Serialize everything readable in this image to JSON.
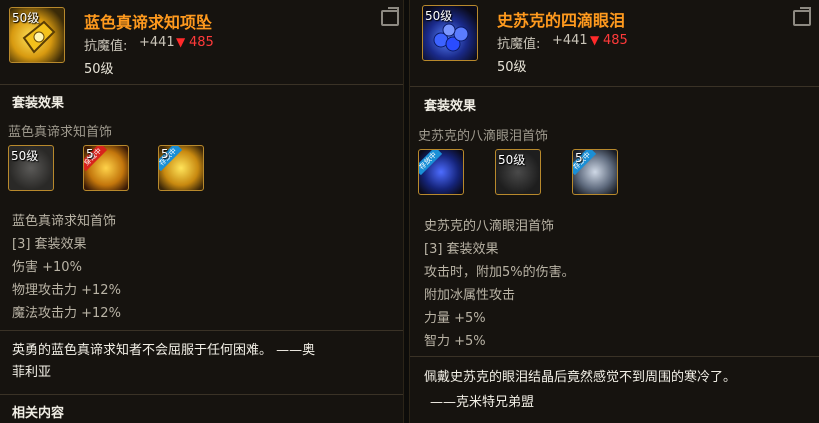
{
  "left": {
    "item_level_tag": "50级",
    "item_name": "蓝色真谛求知项坠",
    "stat_label": "抗魔值:",
    "stat_base": "+441",
    "stat_upgrade": "485",
    "level": "50级",
    "set_header": "套装效果",
    "set_name": "蓝色真谛求知首饰",
    "slots": [
      {
        "tag": "50级",
        "owned": false
      },
      {
        "tag": "5",
        "owned": true,
        "ribbon": "穿戴中"
      },
      {
        "tag": "5",
        "owned": true,
        "ribbon": "存放中"
      }
    ],
    "set_lines": [
      "蓝色真谛求知首饰",
      "[3] 套装效果",
      "伤害 +10%",
      "物理攻击力 +12%",
      "魔法攻击力 +12%"
    ],
    "flavor_lines": [
      "英勇的蓝色真谛求知者不会屈服于任何困难。 ——奥",
      "菲利亚"
    ],
    "related_header": "相关内容"
  },
  "right": {
    "item_level_tag": "50级",
    "item_name": "史苏克的四滴眼泪",
    "stat_label": "抗魔值:",
    "stat_base": "+441",
    "stat_upgrade": "485",
    "level": "50级",
    "set_header": "套装效果",
    "set_name": "史苏克的八滴眼泪首饰",
    "slots": [
      {
        "tag": "",
        "owned": true,
        "ribbon": "存放中"
      },
      {
        "tag": "50级",
        "owned": false
      },
      {
        "tag": "5",
        "owned": true,
        "ribbon": "存放中"
      }
    ],
    "set_lines": [
      "史苏克的八滴眼泪首饰",
      "[3] 套装效果",
      "攻击时，附加5%的伤害。",
      "附加冰属性攻击",
      "力量 +5%",
      "智力 +5%"
    ],
    "flavor_lines": [
      "佩戴史苏克的眼泪结晶后竟然感觉不到周围的寒冷了。",
      "——克米特兄弟盟"
    ]
  },
  "colors": {
    "title": "#ff9a1e",
    "upgrade": "#ff3a3a",
    "frame": "#b8892c"
  }
}
